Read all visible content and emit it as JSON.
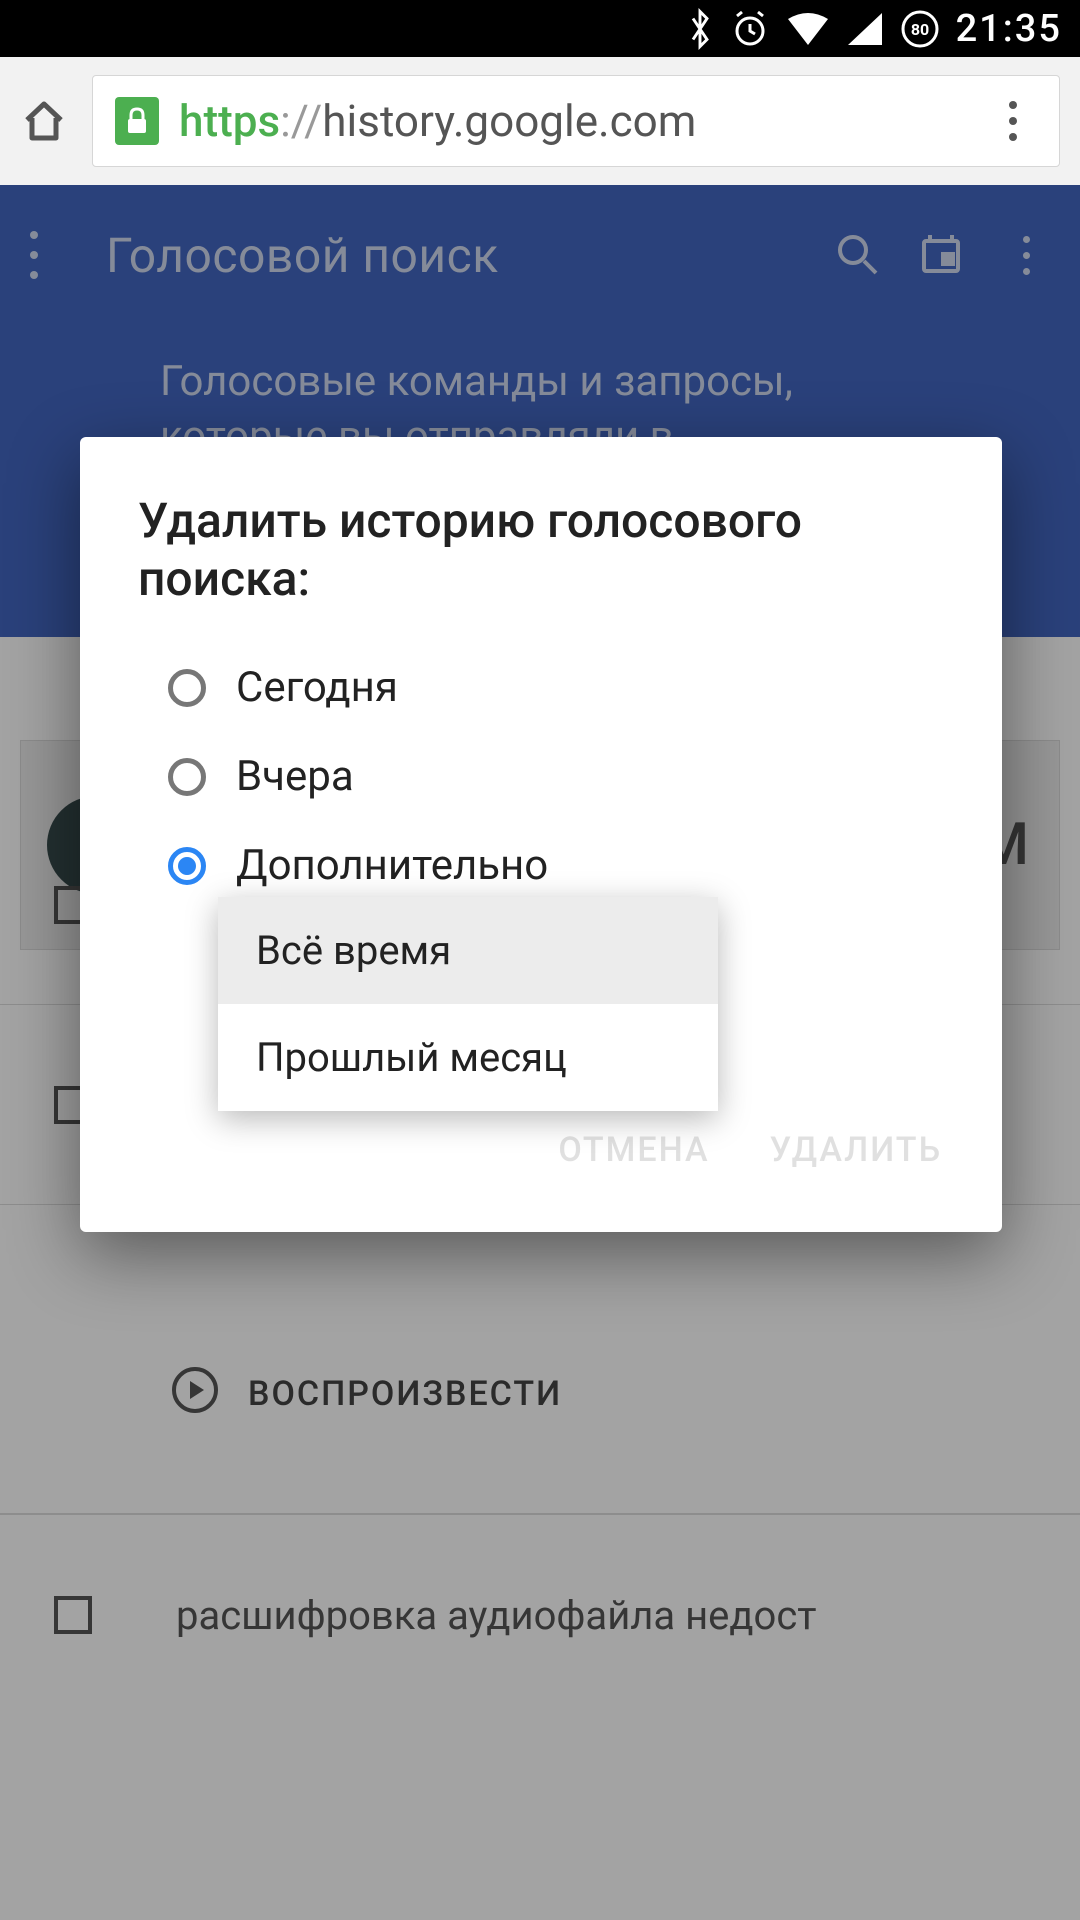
{
  "status": {
    "time": "21:35",
    "battery": "80"
  },
  "browser": {
    "url_scheme": "https",
    "url_sep": "://",
    "url_host": "history.google.com"
  },
  "page": {
    "toolbar_title": "Голосовой поиск",
    "subtitle": "Голосовые команды и запросы, которые вы отправляли в",
    "card_letter": "М",
    "play_label": "ВОСПРОИЗВЕСТИ",
    "row3_label": "расшифровка аудиофайла недост"
  },
  "dialog": {
    "title": "Удалить историю голосового поиска:",
    "options": [
      {
        "label": "Сегодня",
        "selected": false
      },
      {
        "label": "Вчера",
        "selected": false
      },
      {
        "label": "Дополнительно",
        "selected": true
      }
    ],
    "buttons": {
      "cancel": "ОТМЕНА",
      "delete": "УДАЛИТЬ"
    }
  },
  "dropdown": {
    "items": [
      {
        "label": "Всё время",
        "selected": true
      },
      {
        "label": "Прошлый месяц",
        "selected": false
      }
    ]
  }
}
